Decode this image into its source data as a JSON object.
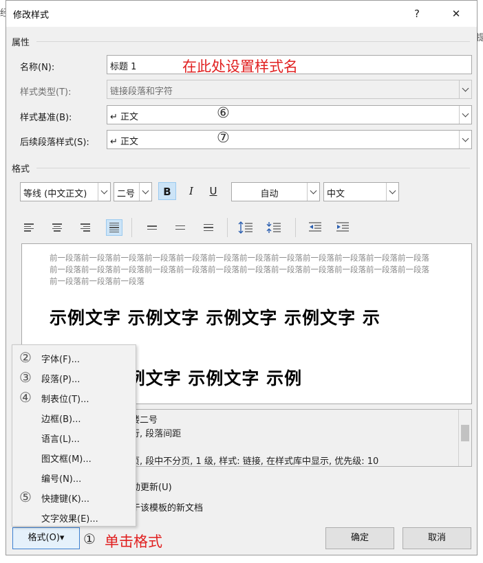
{
  "background_peek": {
    "left_glyph": "经",
    "right_glyph": "提"
  },
  "dialog": {
    "title": "修改样式",
    "help_label": "?",
    "close_label": "✕"
  },
  "properties": {
    "section_label": "属性",
    "name_label": "名称(N):",
    "name_value": "标题 1",
    "name_annotation": "在此处设置样式名",
    "type_label": "样式类型(T):",
    "type_value": "链接段落和字符",
    "based_on_label": "样式基准(B):",
    "based_on_value": "↵ 正文",
    "based_on_marker": "⑥",
    "following_label": "后续段落样式(S):",
    "following_value": "↵ 正文",
    "following_marker": "⑦"
  },
  "format": {
    "section_label": "格式",
    "font_value": "等线 (中文正文)",
    "size_value": "二号",
    "bold_label": "B",
    "italic_label": "I",
    "underline_label": "U",
    "color_value": "自动",
    "language_value": "中文"
  },
  "preview": {
    "previous_paragraph": "前一段落前一段落前一段落前一段落前一段落前一段落前一段落前一段落前一段落前一段落前一段落前一段落前一段落前一段落前一段落前一段落前一段落前一段落前一段落前一段落前一段落前一段落前一段落前一段落前一段落前一段落前一段落",
    "sample_line_1": "示例文字  示例文字  示例文字  示例文字  示",
    "sample_line_2": "例文字  示例文字  示例文字  示例"
  },
  "description": {
    "line1": "楼二号",
    "line2": "行, 段落间距",
    "line3": "页, 段中不分页, 1 级, 样式: 链接, 在样式库中显示, 优先级: 10"
  },
  "options": {
    "auto_update": "动更新(U)",
    "new_docs": "于该模板的新文档"
  },
  "format_menu": {
    "items": [
      {
        "num": "②",
        "label": "字体(F)..."
      },
      {
        "num": "③",
        "label": "段落(P)..."
      },
      {
        "num": "④",
        "label": "制表位(T)..."
      },
      {
        "num": "",
        "label": "边框(B)..."
      },
      {
        "num": "",
        "label": "语言(L)..."
      },
      {
        "num": "",
        "label": "图文框(M)..."
      },
      {
        "num": "",
        "label": "编号(N)..."
      },
      {
        "num": "⑤",
        "label": "快捷键(K)..."
      },
      {
        "num": "",
        "label": "文字效果(E)..."
      }
    ]
  },
  "footer": {
    "format_button": "格式(O)",
    "format_arrow": "▾",
    "step_marker": "①",
    "step_annotation": "单击格式",
    "ok_button": "确定",
    "cancel_button": "取消"
  },
  "colors": {
    "annotation_red": "#e02020",
    "selected_blue": "#cce4f7",
    "dialog_bg": "#f0f0f0"
  }
}
